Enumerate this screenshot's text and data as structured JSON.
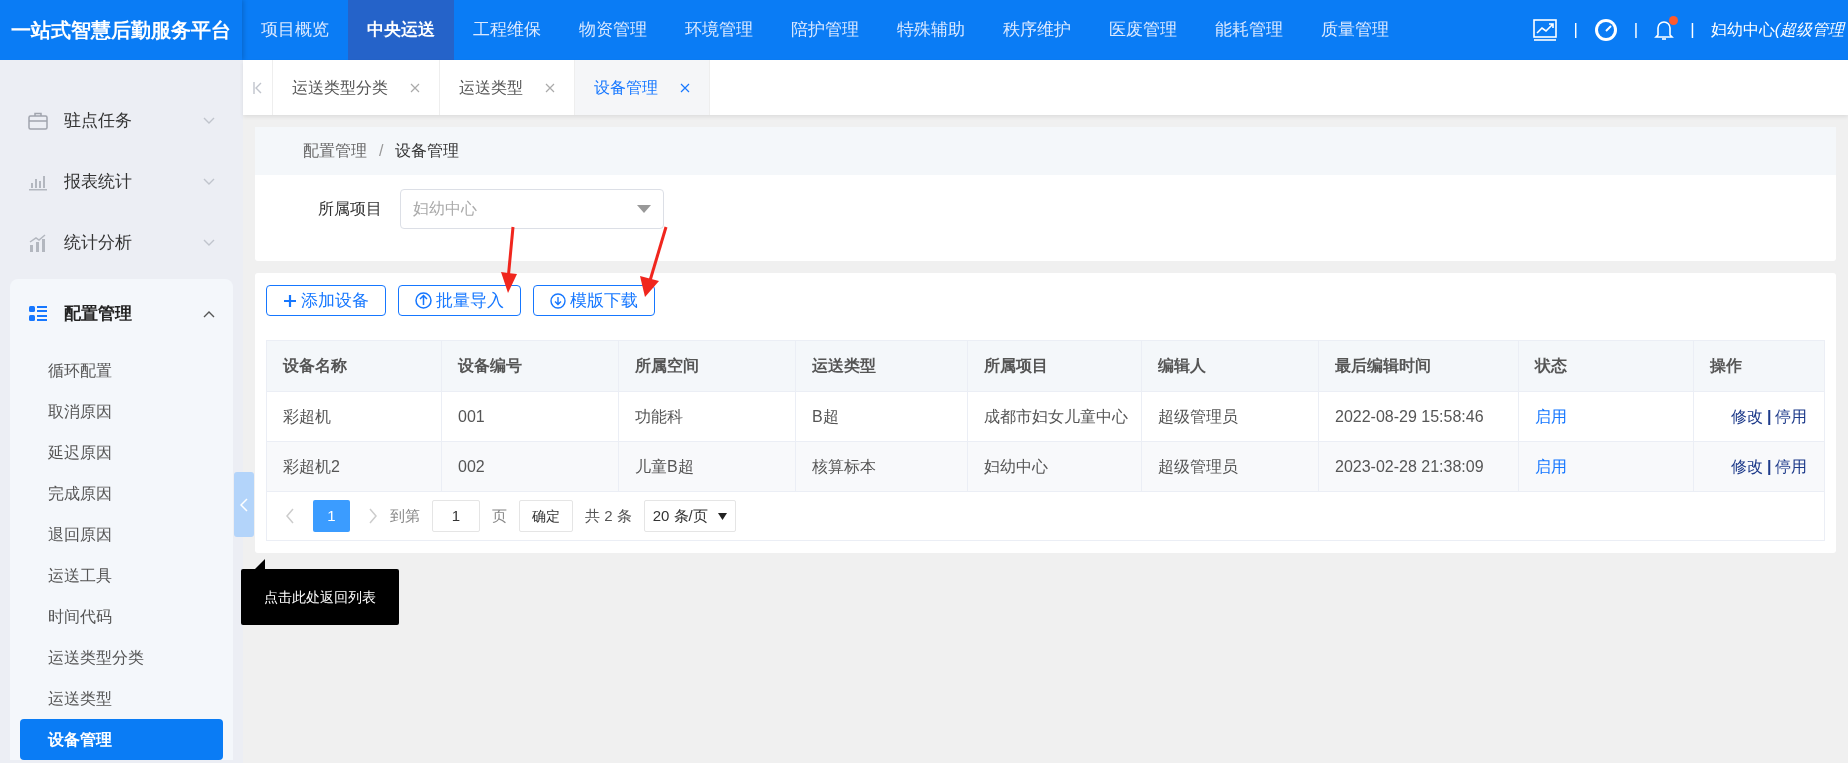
{
  "header": {
    "logo": "一站式智慧后勤服务平台",
    "nav": [
      {
        "label": "项目概览",
        "selected": false
      },
      {
        "label": "中央运送",
        "selected": true
      },
      {
        "label": "工程维保",
        "selected": false
      },
      {
        "label": "物资管理",
        "selected": false
      },
      {
        "label": "环境管理",
        "selected": false
      },
      {
        "label": "陪护管理",
        "selected": false
      },
      {
        "label": "特殊辅助",
        "selected": false
      },
      {
        "label": "秩序维护",
        "selected": false
      },
      {
        "label": "医废管理",
        "selected": false
      },
      {
        "label": "能耗管理",
        "selected": false
      },
      {
        "label": "质量管理",
        "selected": false
      }
    ],
    "separators": [
      "|",
      "|",
      "|"
    ],
    "notification_dot": true,
    "user": "妇幼中心",
    "role": "(超级管理"
  },
  "sidebar": {
    "items": [
      {
        "label": "驻点任务",
        "expanded": false
      },
      {
        "label": "报表统计",
        "expanded": false
      },
      {
        "label": "统计分析",
        "expanded": false
      },
      {
        "label": "配置管理",
        "expanded": true,
        "children": [
          {
            "label": "循环配置",
            "selected": false
          },
          {
            "label": "取消原因",
            "selected": false
          },
          {
            "label": "延迟原因",
            "selected": false
          },
          {
            "label": "完成原因",
            "selected": false
          },
          {
            "label": "退回原因",
            "selected": false
          },
          {
            "label": "运送工具",
            "selected": false
          },
          {
            "label": "时间代码",
            "selected": false
          },
          {
            "label": "运送类型分类",
            "selected": false
          },
          {
            "label": "运送类型",
            "selected": false
          },
          {
            "label": "设备管理",
            "selected": true
          }
        ]
      }
    ]
  },
  "tabs": [
    {
      "label": "运送类型分类",
      "selected": false
    },
    {
      "label": "运送类型",
      "selected": false
    },
    {
      "label": "设备管理",
      "selected": true
    }
  ],
  "breadcrumb": {
    "items": [
      "配置管理",
      "设备管理"
    ],
    "separator": "/"
  },
  "filter": {
    "label": "所属项目",
    "value": "妇幼中心"
  },
  "toolbar": [
    {
      "label": "添加设备"
    },
    {
      "label": "批量导入"
    },
    {
      "label": "模版下载"
    }
  ],
  "table": {
    "columns": [
      "设备名称",
      "设备编号",
      "所属空间",
      "运送类型",
      "所属项目",
      "编辑人",
      "最后编辑时间",
      "状态",
      "操作"
    ],
    "rows": [
      {
        "cells": [
          "彩超机",
          "001",
          "功能科",
          "B超",
          "成都市妇女儿童中心",
          "超级管理员",
          "2022-08-29 15:58:46"
        ],
        "status": "启用",
        "actions": [
          "修改",
          "|",
          "停用"
        ]
      },
      {
        "cells": [
          "彩超机2",
          "002",
          "儿童B超",
          "核算标本",
          "妇幼中心",
          "超级管理员",
          "2023-02-28 21:38:09"
        ],
        "status": "启用",
        "actions": [
          "修改",
          "|",
          "停用"
        ]
      }
    ]
  },
  "pagination": {
    "current": "1",
    "goto_label": "到第",
    "goto_value": "1",
    "page_label": "页",
    "confirm": "确定",
    "total": "共 2 条",
    "page_size": "20 条/页"
  },
  "tooltip": "点击此处返回列表"
}
